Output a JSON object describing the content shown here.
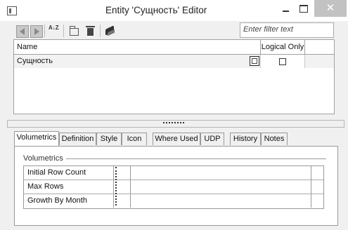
{
  "window": {
    "title": "Entity 'Сущность' Editor",
    "close_glyph": "✕"
  },
  "toolbar": {
    "buttons": [
      "previous-icon",
      "next-icon",
      "sort-icon",
      "new-icon",
      "delete-icon",
      "book-icon"
    ],
    "sort_glyph": "A↓Z"
  },
  "filter": {
    "placeholder": "Enter filter text",
    "value": ""
  },
  "grid": {
    "columns": [
      "Name",
      "Logical Only"
    ],
    "rows": [
      {
        "name": "Сущность",
        "logical_only": false
      }
    ]
  },
  "tabs": [
    {
      "label": "Volumetrics",
      "active": true
    },
    {
      "label": "Definition",
      "active": false
    },
    {
      "label": "Style",
      "active": false
    },
    {
      "label": "Icon",
      "active": false
    },
    {
      "label": "Where Used",
      "active": false
    },
    {
      "label": "UDP",
      "active": false
    },
    {
      "label": "History",
      "active": false
    },
    {
      "label": "Notes",
      "active": false
    }
  ],
  "volumetrics": {
    "group_label": "Volumetrics",
    "rows": [
      {
        "label": "Initial Row Count",
        "value": ""
      },
      {
        "label": "Max Rows",
        "value": ""
      },
      {
        "label": "Growth By Month",
        "value": ""
      }
    ]
  },
  "colors": {
    "active_tab": "#ffffff",
    "selected_row": "#f2f2f2",
    "close_button": "#c2c2c2"
  }
}
